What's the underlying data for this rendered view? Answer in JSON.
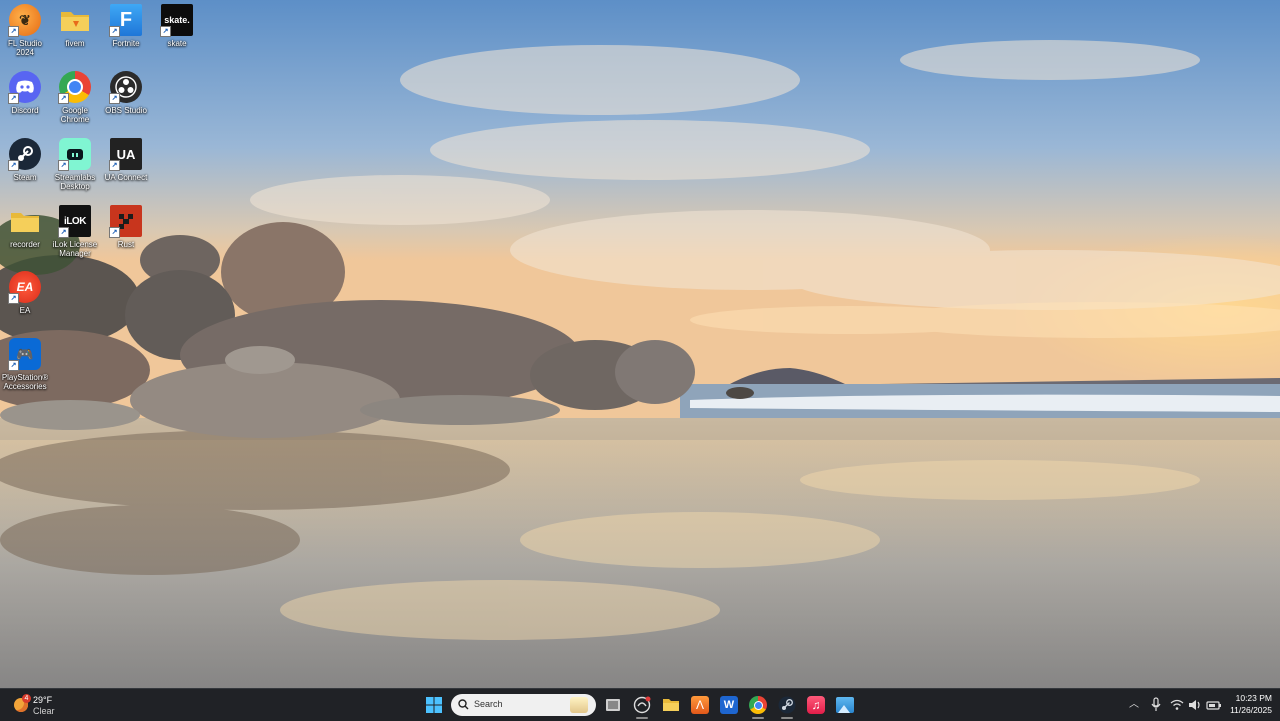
{
  "desktop": {
    "icons": [
      {
        "label": "FL Studio\n2024",
        "icon": "fl-studio-icon"
      },
      {
        "label": "fivem",
        "icon": "folder-icon"
      },
      {
        "label": "Fortnite",
        "icon": "fortnite-icon"
      },
      {
        "label": "skate",
        "icon": "skate-icon"
      },
      {
        "label": "Discord",
        "icon": "discord-icon"
      },
      {
        "label": "Google\nChrome",
        "icon": "chrome-icon"
      },
      {
        "label": "OBS Studio",
        "icon": "obs-icon"
      },
      {
        "label": "Steam",
        "icon": "steam-icon"
      },
      {
        "label": "Streamlabs\nDesktop",
        "icon": "streamlabs-icon"
      },
      {
        "label": "UA Connect",
        "icon": "ua-connect-icon"
      },
      {
        "label": "recorder",
        "icon": "folder-icon"
      },
      {
        "label": "iLok License\nManager",
        "icon": "ilok-icon"
      },
      {
        "label": "Rust",
        "icon": "rust-icon"
      },
      {
        "label": "EA",
        "icon": "ea-icon"
      },
      {
        "label": "PlayStation®\nAccessories",
        "icon": "playstation-accessories-icon"
      }
    ],
    "icon_glyphs": {
      "skate": "skate.",
      "fortnite": "F",
      "ua": "UA",
      "ilok": "iLOK",
      "ea": "EA"
    }
  },
  "taskbar": {
    "weather": {
      "temperature": "29°F",
      "condition": "Clear",
      "badge": "4"
    },
    "search": {
      "placeholder": "Search"
    },
    "apps": [
      "start-icon",
      "task-view-icon",
      "copilot-icon",
      "file-explorer-icon",
      "mixbox-icon",
      "word-icon",
      "chrome-icon",
      "steam-icon",
      "itunes-icon",
      "photos-icon"
    ],
    "tray": {
      "time": "10:23 PM",
      "date": "11/26/2025"
    }
  },
  "colors": {
    "taskbar_bg": "#202226",
    "accent": "#0078d4"
  }
}
